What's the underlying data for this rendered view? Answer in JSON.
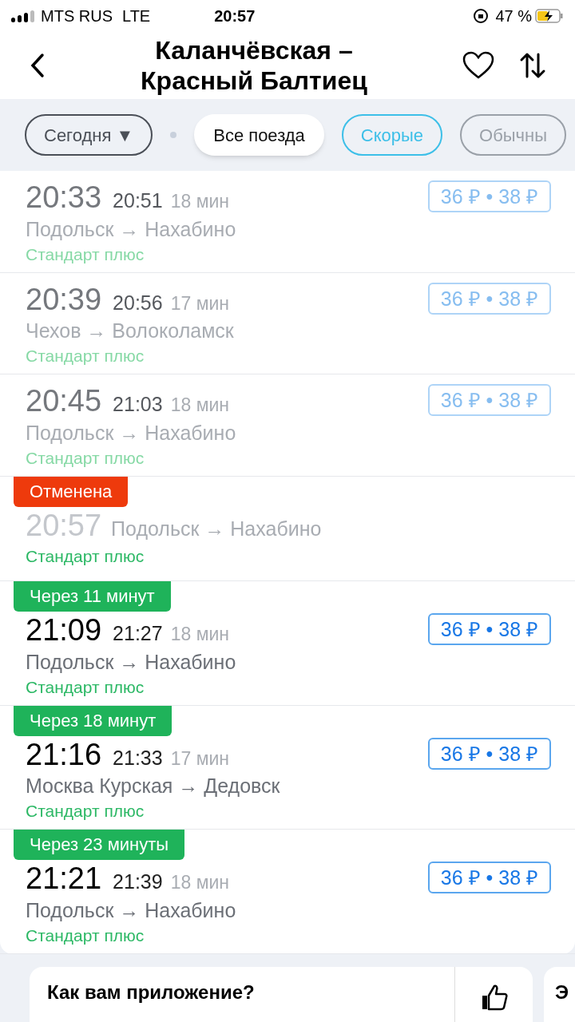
{
  "status_bar": {
    "carrier": "MTS RUS",
    "network": "LTE",
    "time": "20:57",
    "battery": "47 %",
    "charging": true
  },
  "header": {
    "title_line_1": "Каланчёвская –",
    "title_line_2": "Красный Балтиец",
    "favorite": false
  },
  "filters": [
    {
      "label": "Сегодня ▼",
      "selected": false,
      "color": "#4a4f57"
    },
    {
      "label": "Все поезда",
      "selected": true,
      "color": "#ffffff"
    },
    {
      "label": "Скорые",
      "selected": false,
      "color": "#3cbfe8"
    },
    {
      "label": "Обычны",
      "selected": false,
      "color": "#9aa0a8"
    }
  ],
  "trains": [
    {
      "kind": "departed",
      "departure": "20:33",
      "arrival": "20:51",
      "duration": "18 мин",
      "route": "Подольск → Нахабино",
      "category": "Стандарт плюс",
      "price": "36 ₽ • 38 ₽"
    },
    {
      "kind": "departed",
      "departure": "20:39",
      "arrival": "20:56",
      "duration": "17 мин",
      "route": "Чехов → Волоколамск",
      "category": "Стандарт плюс",
      "price": "36 ₽ • 38 ₽"
    },
    {
      "kind": "departed",
      "departure": "20:45",
      "arrival": "21:03",
      "duration": "18 мин",
      "route": "Подольск → Нахабино",
      "category": "Стандарт плюс",
      "price": "36 ₽ • 38 ₽"
    },
    {
      "kind": "cancelled",
      "badge": "Отменена",
      "departure": "20:57",
      "route": "Подольск → Нахабино",
      "category": "Стандарт плюс"
    },
    {
      "kind": "upcoming",
      "badge": "Через 11 минут",
      "departure": "21:09",
      "arrival": "21:27",
      "duration": "18 мин",
      "route": "Подольск → Нахабино",
      "category": "Стандарт плюс",
      "price": "36 ₽ • 38 ₽"
    },
    {
      "kind": "upcoming",
      "badge": "Через 18 минут",
      "departure": "21:16",
      "arrival": "21:33",
      "duration": "17 мин",
      "route": "Москва Курская → Дедовск",
      "category": "Стандарт плюс",
      "price": "36 ₽ • 38 ₽"
    },
    {
      "kind": "upcoming",
      "badge": "Через 23 минуты",
      "departure": "21:21",
      "arrival": "21:39",
      "duration": "18 мин",
      "route": "Подольск → Нахабино",
      "category": "Стандарт плюс",
      "price": "36 ₽ • 38 ₽"
    }
  ],
  "feedback_cards": [
    {
      "title": "Как вам приложение?"
    },
    {
      "title": "Э"
    }
  ]
}
